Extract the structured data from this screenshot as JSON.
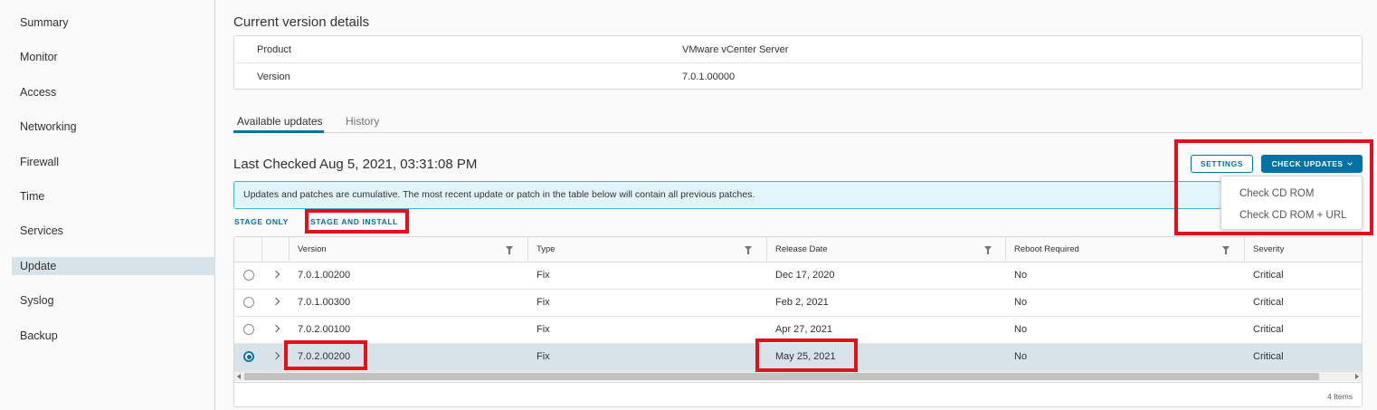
{
  "sidebar": {
    "items": [
      {
        "label": "Summary"
      },
      {
        "label": "Monitor"
      },
      {
        "label": "Access"
      },
      {
        "label": "Networking"
      },
      {
        "label": "Firewall"
      },
      {
        "label": "Time"
      },
      {
        "label": "Services"
      },
      {
        "label": "Update",
        "active": true
      },
      {
        "label": "Syslog"
      },
      {
        "label": "Backup"
      }
    ]
  },
  "current_version": {
    "title": "Current version details",
    "rows": [
      {
        "key": "Product",
        "value": "VMware vCenter Server"
      },
      {
        "key": "Version",
        "value": "7.0.1.00000"
      }
    ]
  },
  "tabs": [
    {
      "label": "Available updates",
      "active": true
    },
    {
      "label": "History",
      "active": false
    }
  ],
  "updates": {
    "last_checked": "Last Checked Aug 5, 2021, 03:31:08 PM",
    "settings_label": "SETTINGS",
    "check_updates_label": "CHECK UPDATES",
    "dropdown_items": [
      "Check CD ROM",
      "Check CD ROM + URL"
    ],
    "alert_text": "Updates and patches are cumulative. The most recent update or patch in the table below will contain all previous patches.",
    "stage_only_label": "STAGE ONLY",
    "stage_install_label": "STAGE AND INSTALL"
  },
  "grid": {
    "columns": [
      "Version",
      "Type",
      "Release Date",
      "Reboot Required",
      "Severity"
    ],
    "rows": [
      {
        "version": "7.0.1.00200",
        "type": "Fix",
        "release_date": "Dec 17, 2020",
        "reboot": "No",
        "severity": "Critical",
        "selected": false
      },
      {
        "version": "7.0.1.00300",
        "type": "Fix",
        "release_date": "Feb 2, 2021",
        "reboot": "No",
        "severity": "Critical",
        "selected": false
      },
      {
        "version": "7.0.2.00100",
        "type": "Fix",
        "release_date": "Apr 27, 2021",
        "reboot": "No",
        "severity": "Critical",
        "selected": false
      },
      {
        "version": "7.0.2.00200",
        "type": "Fix",
        "release_date": "May 25, 2021",
        "reboot": "No",
        "severity": "Critical",
        "selected": true
      }
    ],
    "footer": "4 Items"
  },
  "colors": {
    "accent": "#0072a3",
    "highlight_box": "#e3101b",
    "selected_row": "#d8e3e9",
    "alert_bg": "#e3f5fc"
  }
}
